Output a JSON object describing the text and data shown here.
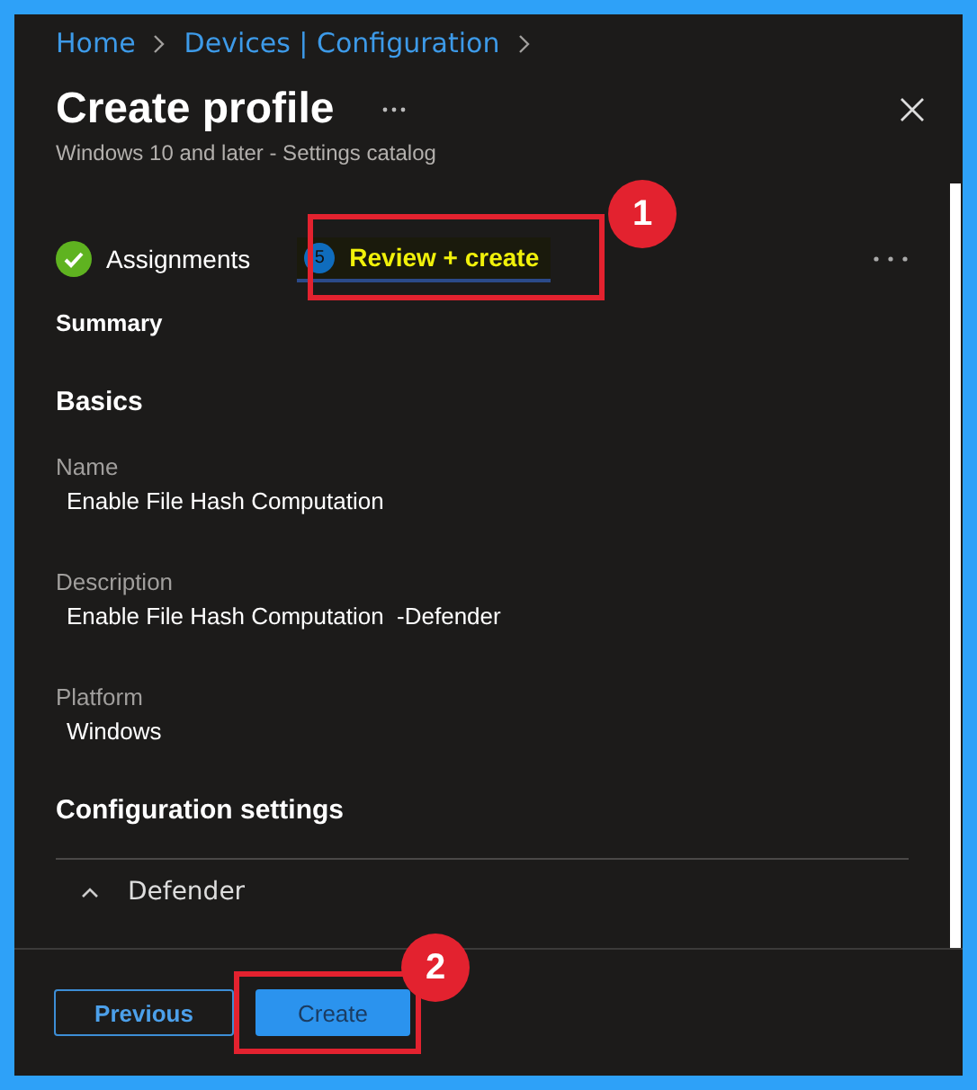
{
  "breadcrumb": [
    "Home",
    "Devices | Configuration"
  ],
  "title": "Create profile",
  "subtitle": "Windows 10 and later - Settings catalog",
  "tabs": [
    {
      "label": "Assignments",
      "kind": "done",
      "selected": false
    },
    {
      "label": "Review + create",
      "kind": "step",
      "step": "5",
      "selected": true
    }
  ],
  "summary_heading": "Summary",
  "sections": [
    {
      "heading": "Basics",
      "fields": [
        {
          "label": "Name",
          "value": "Enable File Hash Computation"
        },
        {
          "label": "Description",
          "value": "Enable File Hash Computation  -Defender"
        },
        {
          "label": "Platform",
          "value": "Windows"
        }
      ]
    },
    {
      "heading": "Configuration settings",
      "groups": [
        {
          "label": "Defender",
          "expanded": true
        }
      ]
    }
  ],
  "footer": {
    "buttons": [
      {
        "label": "Previous",
        "kind": "secondary"
      },
      {
        "label": "Create",
        "kind": "primary"
      }
    ]
  },
  "callouts": [
    "1",
    "2"
  ]
}
